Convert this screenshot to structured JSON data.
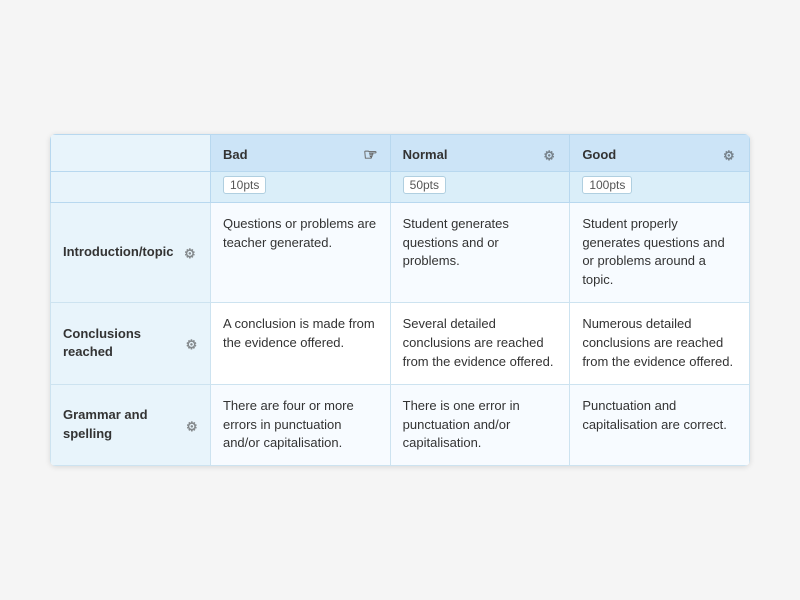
{
  "columns": {
    "bad": {
      "label": "Bad",
      "pts": "10pts",
      "has_cursor": true
    },
    "normal": {
      "label": "Normal",
      "pts": "50pts",
      "has_cursor": false
    },
    "good": {
      "label": "Good",
      "pts": "100pts",
      "has_cursor": false
    }
  },
  "rows": [
    {
      "header": "Introduction/topic",
      "bad": "Questions or problems are teacher generated.",
      "normal": "Student generates questions and or problems.",
      "good": "Student properly generates questions and or problems around a topic."
    },
    {
      "header": "Conclusions reached",
      "bad": "A conclusion is made from the evidence offered.",
      "normal": "Several detailed conclusions are reached from the evidence offered.",
      "good": "Numerous detailed conclusions are reached from the evidence offered."
    },
    {
      "header": "Grammar and spelling",
      "bad": "There are four or more errors in punctuation and/or capitalisation.",
      "normal": "There is one error in punctuation and/or capitalisation.",
      "good": "Punctuation and capitalisation are correct."
    }
  ],
  "icons": {
    "gear": "⚙",
    "cursor": "☜"
  }
}
